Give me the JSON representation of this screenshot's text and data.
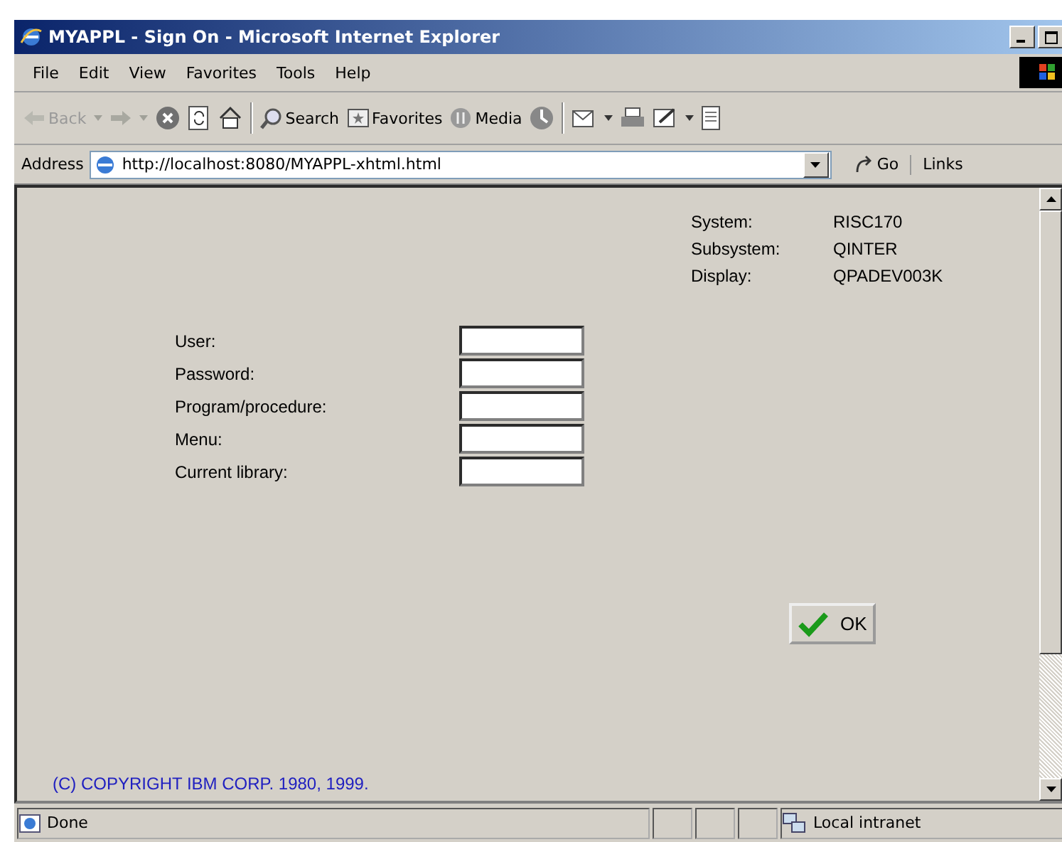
{
  "window": {
    "title": "MYAPPL - Sign On - Microsoft Internet Explorer"
  },
  "menu": [
    "File",
    "Edit",
    "View",
    "Favorites",
    "Tools",
    "Help"
  ],
  "toolbar": {
    "back": "Back",
    "search": "Search",
    "favorites": "Favorites",
    "media": "Media"
  },
  "address_bar": {
    "label": "Address",
    "url": "http://localhost:8080/MYAPPL-xhtml.html",
    "go": "Go",
    "links": "Links"
  },
  "system_info": [
    {
      "label": "System:",
      "value": "RISC170"
    },
    {
      "label": "Subsystem:",
      "value": "QINTER"
    },
    {
      "label": "Display:",
      "value": "QPADEV003K"
    }
  ],
  "fields": [
    {
      "label": "User:"
    },
    {
      "label": "Password:"
    },
    {
      "label": "Program/procedure:"
    },
    {
      "label": "Menu:"
    },
    {
      "label": "Current library:"
    }
  ],
  "ok_button": "OK",
  "copyright": "(C) COPYRIGHT IBM CORP. 1980, 1999.",
  "status_bar": {
    "status": "Done",
    "zone": "Local intranet"
  }
}
